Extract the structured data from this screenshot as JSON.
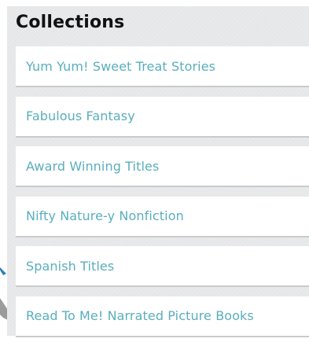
{
  "collections": {
    "title": "Collections",
    "items": [
      {
        "label": "Yum Yum! Sweet Treat Stories"
      },
      {
        "label": "Fabulous Fantasy"
      },
      {
        "label": "Award Winning Titles"
      },
      {
        "label": "Nifty Nature-y Nonfiction"
      },
      {
        "label": "Spanish Titles"
      },
      {
        "label": "Read To Me! Narrated Picture Books"
      }
    ]
  },
  "colors": {
    "panel_background": "#e6e7e8",
    "item_background": "#ffffff",
    "link_text": "#5aaebd",
    "title_text": "#111111"
  }
}
